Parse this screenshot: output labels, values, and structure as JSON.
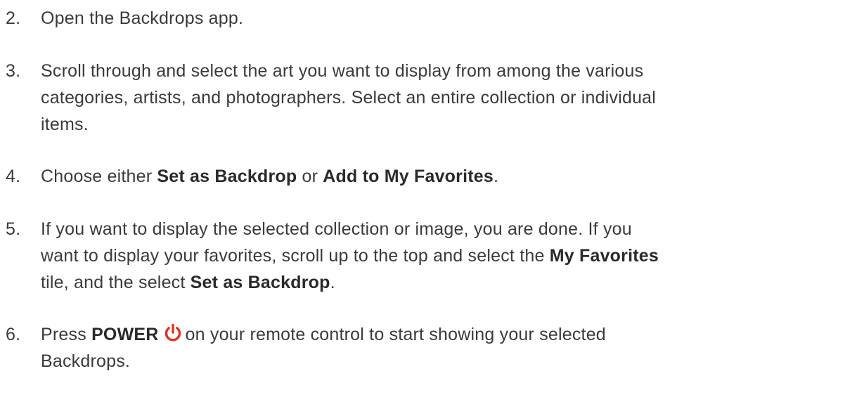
{
  "steps": [
    {
      "number": "2.",
      "lines": [
        {
          "parts": [
            {
              "text": "Open the Backdrops app."
            }
          ]
        }
      ]
    },
    {
      "number": "3.",
      "lines": [
        {
          "parts": [
            {
              "text": "Scroll through and select the art you want to display from among the various"
            }
          ]
        },
        {
          "parts": [
            {
              "text": "categories, artists, and photographers. Select an entire collection or individual"
            }
          ]
        },
        {
          "parts": [
            {
              "text": "items."
            }
          ]
        }
      ]
    },
    {
      "number": "4.",
      "lines": [
        {
          "parts": [
            {
              "text": "Choose either "
            },
            {
              "text": "Set as Backdrop",
              "bold": true
            },
            {
              "text": " or "
            },
            {
              "text": "Add to My Favorites",
              "bold": true
            },
            {
              "text": "."
            }
          ]
        }
      ]
    },
    {
      "number": "5.",
      "lines": [
        {
          "parts": [
            {
              "text": "If you want to display the selected collection or image, you are done. If you"
            }
          ]
        },
        {
          "parts": [
            {
              "text": "want to display your favorites, scroll up to the top and select the "
            },
            {
              "text": "My Favorites",
              "bold": true
            }
          ]
        },
        {
          "parts": [
            {
              "text": "tile, and the select "
            },
            {
              "text": "Set as Backdrop",
              "bold": true
            },
            {
              "text": "."
            }
          ]
        }
      ]
    },
    {
      "number": "6.",
      "lines": [
        {
          "parts": [
            {
              "text": "Press "
            },
            {
              "text": "POWER",
              "bold": true
            },
            {
              "icon": "power-icon"
            },
            {
              "text": "on your remote control to start showing your selected"
            }
          ]
        },
        {
          "parts": [
            {
              "text": "Backdrops."
            }
          ]
        }
      ]
    }
  ],
  "colors": {
    "text": "#3a3a3a",
    "bold_text": "#2a2a2a",
    "power_icon": "#e4301d"
  }
}
